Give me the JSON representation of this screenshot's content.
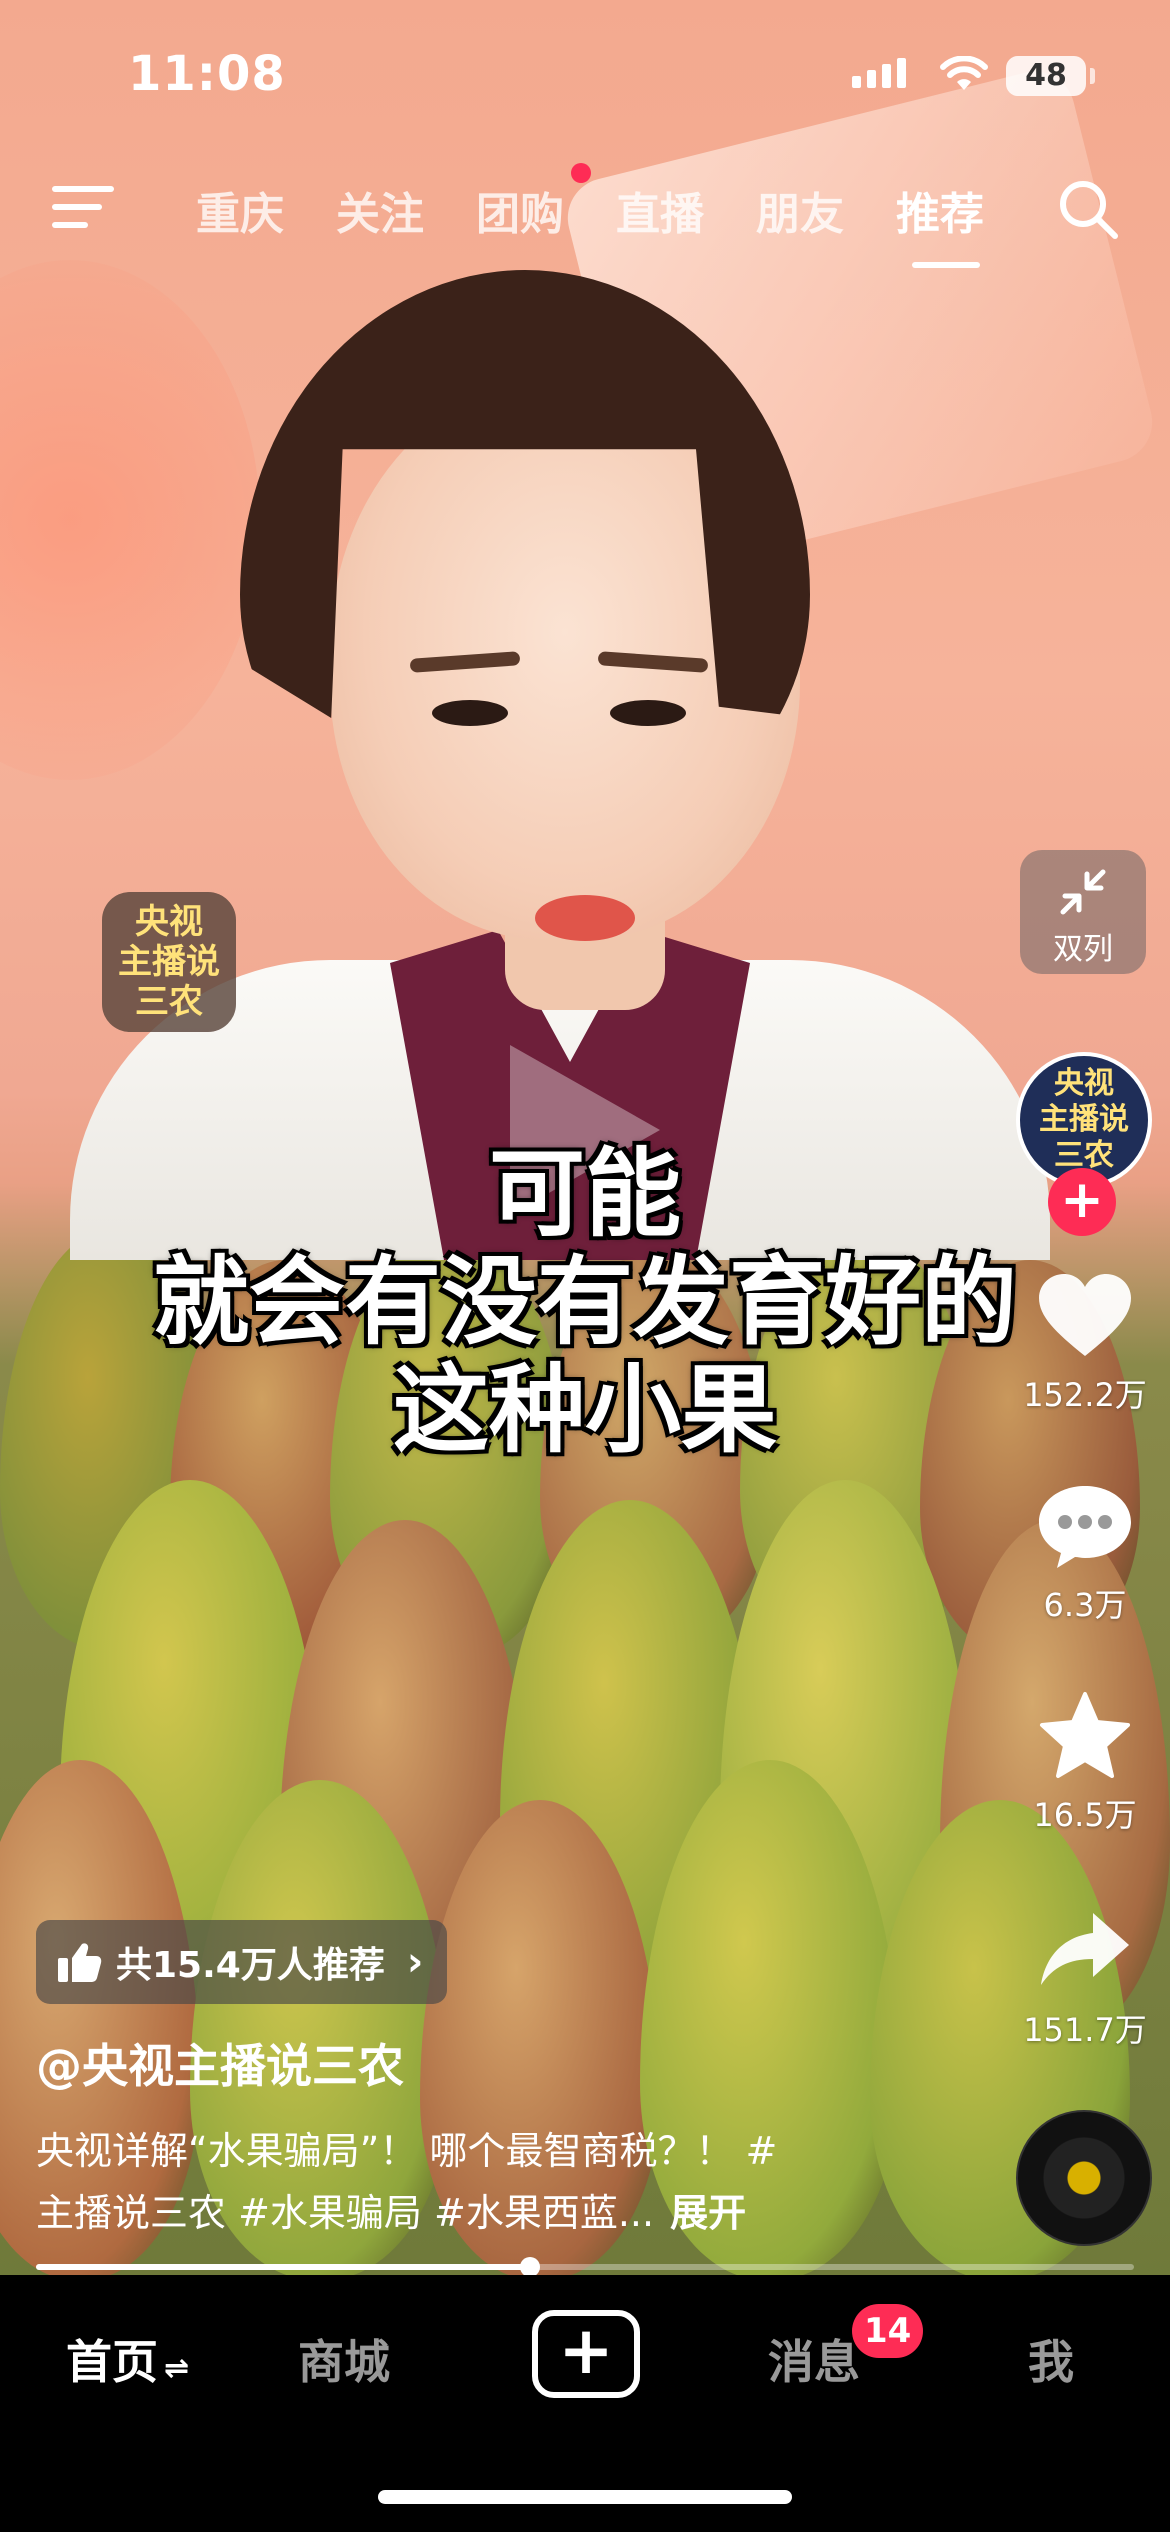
{
  "status_bar": {
    "time": "11:08",
    "battery": "48"
  },
  "top_nav": {
    "tabs": [
      {
        "label": "重庆",
        "active": false
      },
      {
        "label": "关注",
        "active": false
      },
      {
        "label": "团购",
        "active": false,
        "dot": true
      },
      {
        "label": "直播",
        "active": false
      },
      {
        "label": "朋友",
        "active": false
      },
      {
        "label": "推荐",
        "active": true
      }
    ]
  },
  "video": {
    "logo_badge": [
      "央视",
      "主播说",
      "三农"
    ],
    "subtitle_lines": [
      "可能",
      "就会有没有发育好的",
      "这种小果"
    ]
  },
  "right_rail": {
    "dual_column_label": "双列",
    "avatar_lines": [
      "央视",
      "主播说",
      "三农"
    ],
    "like_count": "152.2万",
    "comment_count": "6.3万",
    "favorite_count": "16.5万",
    "share_count": "151.7万"
  },
  "info": {
    "recommend_text": "共15.4万人推荐",
    "author": "@央视主播说三农",
    "description_line1": "央视详解“水果骗局”！ 哪个最智商税？！ #",
    "description_line2": "主播说三农 #水果骗局 #水果西蓝...",
    "expand_label": "展开"
  },
  "playback": {
    "progress": 0.45
  },
  "bottom_tabs": {
    "home": "首页",
    "home_switch_icon": "⇌",
    "mall": "商城",
    "create_symbol": "+",
    "messages": "消息",
    "messages_badge": "14",
    "me": "我"
  },
  "colors": {
    "accent": "#fe2c55",
    "tabbar_bg": "#000000"
  }
}
